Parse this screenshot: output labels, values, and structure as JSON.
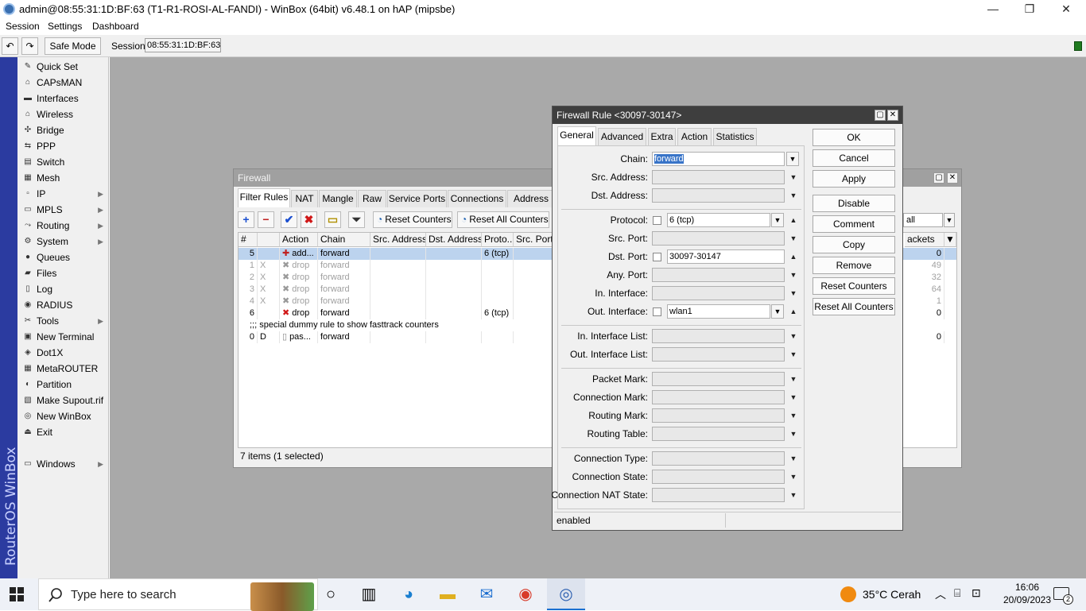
{
  "window": {
    "title": "admin@08:55:31:1D:BF:63 (T1-R1-ROSI-AL-FANDI) - WinBox (64bit) v6.48.1 on hAP (mipsbe)",
    "minimize": "—",
    "maximize": "❐",
    "close": "✕"
  },
  "menu": [
    "Session",
    "Settings",
    "Dashboard"
  ],
  "toolbar": {
    "undo": "↶",
    "redo": "↷",
    "safe_mode": "Safe Mode",
    "session_label": "Session:",
    "session_value": "08:55:31:1D:BF:63"
  },
  "sidebar": {
    "brand": "RouterOS WinBox",
    "items": [
      {
        "label": "Quick Set",
        "icon": "wand-icon",
        "glyph": "✎",
        "submenu": false
      },
      {
        "label": "CAPsMAN",
        "icon": "antenna-icon",
        "glyph": "⌂",
        "submenu": false
      },
      {
        "label": "Interfaces",
        "icon": "interfaces-icon",
        "glyph": "▬",
        "submenu": false
      },
      {
        "label": "Wireless",
        "icon": "wireless-icon",
        "glyph": "⌂",
        "submenu": false
      },
      {
        "label": "Bridge",
        "icon": "bridge-icon",
        "glyph": "✣",
        "submenu": false
      },
      {
        "label": "PPP",
        "icon": "ppp-icon",
        "glyph": "⇆",
        "submenu": false
      },
      {
        "label": "Switch",
        "icon": "switch-icon",
        "glyph": "▤",
        "submenu": false
      },
      {
        "label": "Mesh",
        "icon": "mesh-icon",
        "glyph": "▦",
        "submenu": false
      },
      {
        "label": "IP",
        "icon": "ip-icon",
        "glyph": "▫",
        "submenu": true
      },
      {
        "label": "MPLS",
        "icon": "mpls-icon",
        "glyph": "▭",
        "submenu": true
      },
      {
        "label": "Routing",
        "icon": "routing-icon",
        "glyph": "⤳",
        "submenu": true
      },
      {
        "label": "System",
        "icon": "gear-icon",
        "glyph": "⚙",
        "submenu": true
      },
      {
        "label": "Queues",
        "icon": "queues-icon",
        "glyph": "●",
        "submenu": false
      },
      {
        "label": "Files",
        "icon": "folder-icon",
        "glyph": "▰",
        "submenu": false
      },
      {
        "label": "Log",
        "icon": "log-icon",
        "glyph": "▯",
        "submenu": false
      },
      {
        "label": "RADIUS",
        "icon": "radius-icon",
        "glyph": "◉",
        "submenu": false
      },
      {
        "label": "Tools",
        "icon": "tools-icon",
        "glyph": "✂",
        "submenu": true
      },
      {
        "label": "New Terminal",
        "icon": "terminal-icon",
        "glyph": "▣",
        "submenu": false
      },
      {
        "label": "Dot1X",
        "icon": "dot1x-icon",
        "glyph": "◈",
        "submenu": false
      },
      {
        "label": "MetaROUTER",
        "icon": "metarouter-icon",
        "glyph": "▦",
        "submenu": false
      },
      {
        "label": "Partition",
        "icon": "partition-icon",
        "glyph": "◐",
        "submenu": false
      },
      {
        "label": "Make Supout.rif",
        "icon": "supout-icon",
        "glyph": "▧",
        "submenu": false
      },
      {
        "label": "New WinBox",
        "icon": "winbox-icon",
        "glyph": "◎",
        "submenu": false
      },
      {
        "label": "Exit",
        "icon": "exit-icon",
        "glyph": "⏏",
        "submenu": false
      },
      {
        "label": "Windows",
        "icon": "windows-icon",
        "glyph": "▭",
        "submenu": true
      }
    ]
  },
  "firewall": {
    "title": "Firewall",
    "tabs": [
      "Filter Rules",
      "NAT",
      "Mangle",
      "Raw",
      "Service Ports",
      "Connections",
      "Address Lis"
    ],
    "reset_counters": "Reset Counters",
    "reset_all_counters": "Reset All Counters",
    "filter_value": "all",
    "columns": [
      "#",
      "Action",
      "Chain",
      "Src. Address",
      "Dst. Address",
      "Proto...",
      "Src. Port"
    ],
    "packets_header": "ackets",
    "rows": [
      {
        "num": "5",
        "flag": "",
        "action": "add...",
        "chain": "forward",
        "proto": "6 (tcp)",
        "packets": "0",
        "selected": true,
        "disabled": false,
        "icon": "add-icon"
      },
      {
        "num": "1",
        "flag": "X",
        "action": "drop",
        "chain": "forward",
        "proto": "",
        "packets": "49",
        "selected": false,
        "disabled": true,
        "icon": "drop-icon"
      },
      {
        "num": "2",
        "flag": "X",
        "action": "drop",
        "chain": "forward",
        "proto": "",
        "packets": "32",
        "selected": false,
        "disabled": true,
        "icon": "drop-icon"
      },
      {
        "num": "3",
        "flag": "X",
        "action": "drop",
        "chain": "forward",
        "proto": "",
        "packets": "64",
        "selected": false,
        "disabled": true,
        "icon": "drop-icon"
      },
      {
        "num": "4",
        "flag": "X",
        "action": "drop",
        "chain": "forward",
        "proto": "",
        "packets": "1",
        "selected": false,
        "disabled": true,
        "icon": "drop-icon"
      },
      {
        "num": "6",
        "flag": "",
        "action": "drop",
        "chain": "forward",
        "proto": "6 (tcp)",
        "packets": "0",
        "selected": false,
        "disabled": false,
        "icon": "drop-icon"
      }
    ],
    "comment_row": ";;; special dummy rule to show fasttrack counters",
    "last_row": {
      "num": "0",
      "flag": "D",
      "action": "pas...",
      "chain": "forward",
      "packets": "0"
    },
    "status": "7 items (1 selected)"
  },
  "rule": {
    "title": "Firewall Rule <30097-30147>",
    "tabs": [
      "General",
      "Advanced",
      "Extra",
      "Action",
      "Statistics"
    ],
    "fields": {
      "chain_label": "Chain:",
      "chain_value": "forward",
      "src_address": "Src. Address:",
      "dst_address": "Dst. Address:",
      "protocol_label": "Protocol:",
      "protocol_value": "6 (tcp)",
      "src_port": "Src. Port:",
      "dst_port_label": "Dst. Port:",
      "dst_port_value": "30097-30147",
      "any_port": "Any. Port:",
      "in_interface": "In. Interface:",
      "out_interface_label": "Out. Interface:",
      "out_interface_value": "wlan1",
      "in_interface_list": "In. Interface List:",
      "out_interface_list": "Out. Interface List:",
      "packet_mark": "Packet Mark:",
      "connection_mark": "Connection Mark:",
      "routing_mark": "Routing Mark:",
      "routing_table": "Routing Table:",
      "connection_type": "Connection Type:",
      "connection_state": "Connection State:",
      "connection_nat_state": "Connection NAT State:"
    },
    "buttons": [
      "OK",
      "Cancel",
      "Apply",
      "Disable",
      "Comment",
      "Copy",
      "Remove",
      "Reset Counters",
      "Reset All Counters"
    ],
    "status": "enabled"
  },
  "taskbar": {
    "search_placeholder": "Type here to search",
    "weather": "35°C  Cerah",
    "time": "16:06",
    "date": "20/09/2023",
    "notifications": "2"
  }
}
